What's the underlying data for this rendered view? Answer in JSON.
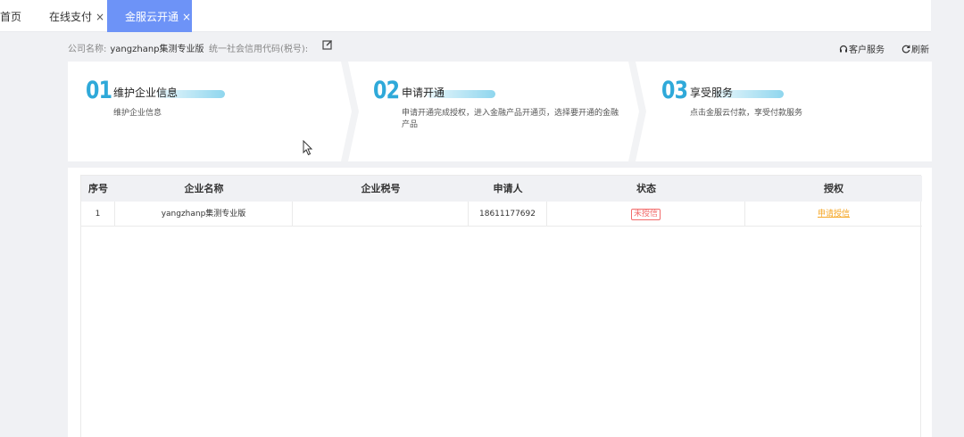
{
  "tabs": [
    {
      "label": "首页",
      "closable": false
    },
    {
      "label": "在线支付",
      "closable": true
    },
    {
      "label": "金服云开通",
      "closable": true,
      "active": true
    }
  ],
  "tab_close_glyph": "×",
  "info": {
    "company_label": "公司名称:",
    "company_value": "yangzhanp集测专业版",
    "credit_label": "统一社会信用代码(税号):",
    "service_label": "客户服务",
    "refresh_label": "刷新"
  },
  "steps": [
    {
      "num": "01",
      "title": "维护企业信息",
      "desc": "维护企业信息"
    },
    {
      "num": "02",
      "title": "申请开通",
      "desc": "申请开通完成授权，进入金融产品开通页，选择要开通的金融产品"
    },
    {
      "num": "03",
      "title": "享受服务",
      "desc": "点击金服云付款，享受付款服务"
    }
  ],
  "table": {
    "headers": [
      "序号",
      "企业名称",
      "企业税号",
      "申请人",
      "状态",
      "授权"
    ],
    "rows": [
      {
        "index": "1",
        "company": "yangzhanp集测专业版",
        "tax_id": "",
        "applicant": "18611177692",
        "status": "未授信",
        "action": "申请授信"
      }
    ]
  },
  "colors": {
    "active_tab": "#6d93f7",
    "step_number": "#2fa9d9",
    "status_unauthorized": "#f26b6b",
    "action_link": "#f5a623"
  },
  "icons": [
    "edit-icon",
    "headset-icon",
    "refresh-icon",
    "close-icon",
    "mouse-cursor-icon"
  ]
}
